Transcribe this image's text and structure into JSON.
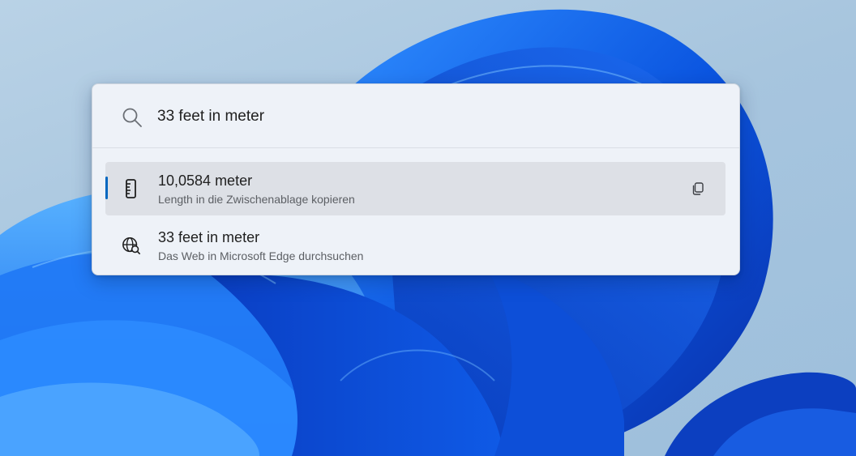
{
  "search": {
    "query": "33 feet in meter",
    "icon": "search-icon"
  },
  "results": [
    {
      "title": "10,0584 meter",
      "subtitle": "Length in die Zwischenablage kopieren",
      "icon": "ruler-icon",
      "action_icon": "copy-icon",
      "selected": true
    },
    {
      "title": "33 feet in meter",
      "subtitle": "Das Web in Microsoft Edge durchsuchen",
      "icon": "web-search-icon",
      "selected": false
    }
  ],
  "colors": {
    "accent": "#0067c0",
    "palette_background": "#eef2f8",
    "selected_background": "#dde0e6",
    "wallpaper_blue": "#0a4fd6"
  }
}
